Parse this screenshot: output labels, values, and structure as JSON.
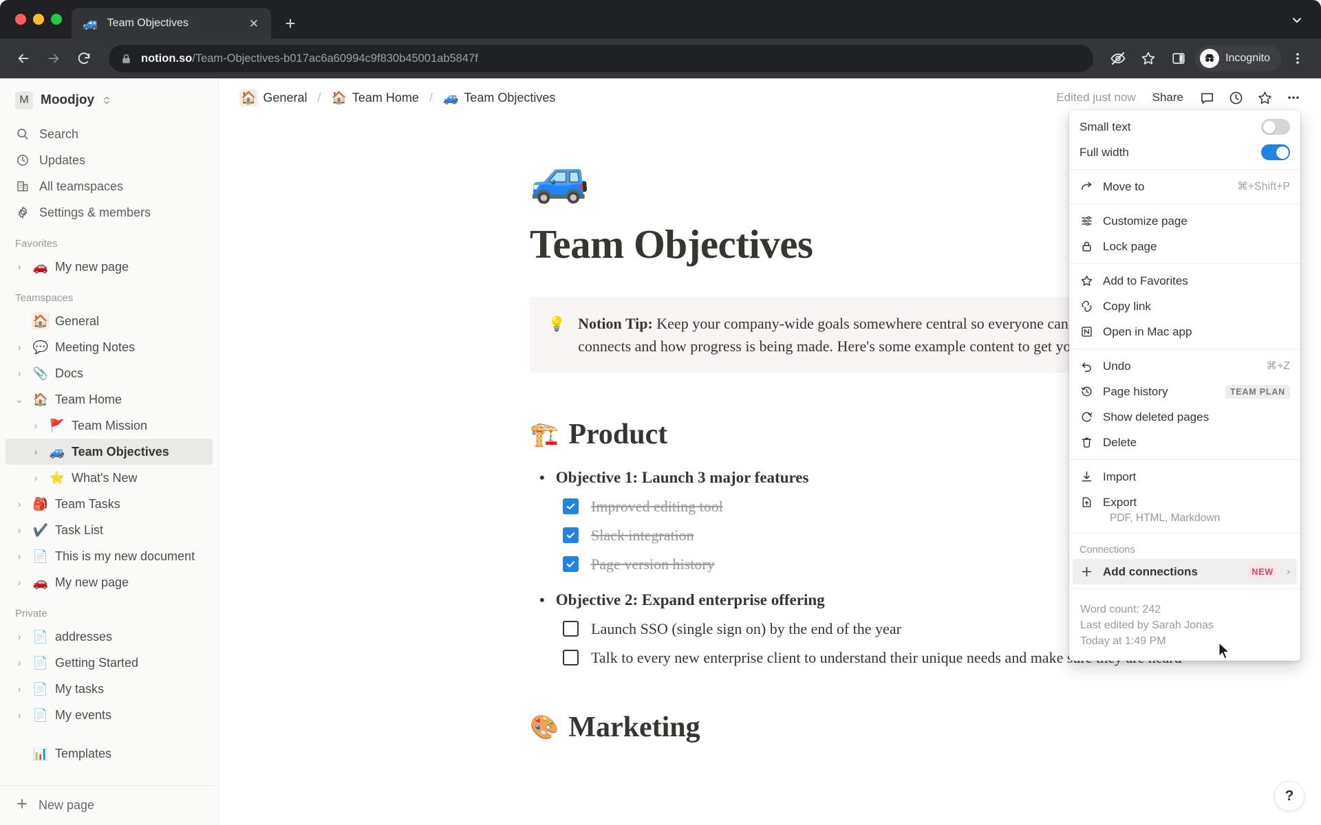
{
  "browser": {
    "tab": {
      "title": "Team Objectives",
      "favicon": "🚙",
      "close_label": "✕"
    },
    "new_tab_label": "+",
    "tab_list_label": "⌄",
    "url_host": "notion.so",
    "url_path": "/Team-Objectives-b017ac6a60994c9f830b45001ab5847f",
    "profile_label": "Incognito",
    "nav": {
      "back": "←",
      "forward": "→",
      "reload": "⟳"
    }
  },
  "sidebar": {
    "workspace": {
      "initial": "M",
      "name": "Moodjoy"
    },
    "nav": [
      {
        "label": "Search",
        "icon": "search-icon"
      },
      {
        "label": "Updates",
        "icon": "clock-icon"
      },
      {
        "label": "All teamspaces",
        "icon": "building-icon"
      },
      {
        "label": "Settings & members",
        "icon": "gear-icon"
      }
    ],
    "sections": [
      {
        "title": "Favorites",
        "items": [
          {
            "label": "My new page",
            "emoji": "🚗",
            "twisty": true,
            "indent": 0,
            "selected": false
          }
        ]
      },
      {
        "title": "Teamspaces",
        "items": [
          {
            "label": "General",
            "emoji": "🏠",
            "twisty": false,
            "indent": 0,
            "selected": false,
            "boxed": true
          },
          {
            "label": "Meeting Notes",
            "emoji": "💬",
            "twisty": true,
            "indent": 0,
            "selected": false
          },
          {
            "label": "Docs",
            "emoji": "📎",
            "twisty": true,
            "indent": 0,
            "selected": false
          },
          {
            "label": "Team Home",
            "emoji": "🏠",
            "twisty": true,
            "expanded": true,
            "indent": 0,
            "selected": false
          },
          {
            "label": "Team Mission",
            "emoji": "🚩",
            "twisty": true,
            "indent": 1,
            "selected": false
          },
          {
            "label": "Team Objectives",
            "emoji": "🚙",
            "twisty": true,
            "indent": 1,
            "selected": true
          },
          {
            "label": "What's New",
            "emoji": "⭐",
            "twisty": true,
            "indent": 1,
            "selected": false
          },
          {
            "label": "Team Tasks",
            "emoji": "🎒",
            "twisty": true,
            "indent": 0,
            "selected": false
          },
          {
            "label": "Task List",
            "emoji": "✔️",
            "twisty": true,
            "indent": 0,
            "selected": false
          },
          {
            "label": "This is my new document",
            "emoji": "📄",
            "twisty": true,
            "indent": 0,
            "selected": false
          },
          {
            "label": "My new page",
            "emoji": "🚗",
            "twisty": true,
            "indent": 0,
            "selected": false
          }
        ]
      },
      {
        "title": "Private",
        "items": [
          {
            "label": "addresses",
            "emoji": "📄",
            "twisty": true,
            "indent": 0,
            "selected": false
          },
          {
            "label": "Getting Started",
            "emoji": "📄",
            "twisty": true,
            "indent": 0,
            "selected": false
          },
          {
            "label": "My tasks",
            "emoji": "📄",
            "twisty": true,
            "indent": 0,
            "selected": false
          },
          {
            "label": "My events",
            "emoji": "📄",
            "twisty": true,
            "indent": 0,
            "selected": false
          },
          {
            "label": "Templates",
            "emoji": "📊",
            "twisty": false,
            "indent": 0,
            "selected": false
          }
        ]
      }
    ],
    "footer": {
      "label": "New page",
      "icon": "plus-icon"
    }
  },
  "topbar": {
    "breadcrumbs": [
      {
        "label": "General",
        "emoji": "🏠",
        "boxed": true
      },
      {
        "label": "Team Home",
        "emoji": "🏠",
        "boxed": false
      },
      {
        "label": "Team Objectives",
        "emoji": "🚙",
        "boxed": false
      }
    ],
    "separator": "/",
    "edited_status": "Edited just now",
    "share_label": "Share",
    "icons": [
      "comment-icon",
      "history-icon",
      "star-icon",
      "more-icon"
    ]
  },
  "page": {
    "emoji": "🚙",
    "title": "Team Objectives",
    "callout": {
      "emoji": "💡",
      "bold_prefix": "Notion Tip:",
      "text": " Keep your company-wide goals somewhere central so everyone can see how their work connects and how progress is being made. Here's some example content to get your started:"
    },
    "sections": [
      {
        "emoji": "🏗️",
        "heading": "Product",
        "objectives": [
          {
            "label": "Objective 1: Launch 3 major features",
            "todos": [
              {
                "text": "Improved editing tool",
                "checked": true
              },
              {
                "text": "Slack integration",
                "checked": true
              },
              {
                "text": "Page version history",
                "checked": true
              }
            ]
          },
          {
            "label": "Objective 2: Expand enterprise offering",
            "todos": [
              {
                "text": "Launch SSO (single sign on) by the end of the year",
                "checked": false
              },
              {
                "text": "Talk to every new enterprise client to understand their unique needs and make sure they are heard",
                "checked": false
              }
            ]
          }
        ]
      },
      {
        "emoji": "🎨",
        "heading": "Marketing",
        "objectives": []
      }
    ]
  },
  "menu": {
    "toggles": [
      {
        "label": "Small text",
        "on": false
      },
      {
        "label": "Full width",
        "on": true
      }
    ],
    "groups": [
      {
        "items": [
          {
            "label": "Move to",
            "icon": "arrow-move-icon",
            "shortcut": "⌘+Shift+P"
          }
        ]
      },
      {
        "items": [
          {
            "label": "Customize page",
            "icon": "sliders-icon"
          },
          {
            "label": "Lock page",
            "icon": "lock-icon"
          }
        ]
      },
      {
        "items": [
          {
            "label": "Add to Favorites",
            "icon": "star-icon"
          },
          {
            "label": "Copy link",
            "icon": "link-icon"
          },
          {
            "label": "Open in Mac app",
            "icon": "notion-app-icon"
          }
        ]
      },
      {
        "items": [
          {
            "label": "Undo",
            "icon": "undo-icon",
            "shortcut": "⌘+Z"
          },
          {
            "label": "Page history",
            "icon": "history-icon",
            "badge": "TEAM PLAN"
          },
          {
            "label": "Show deleted pages",
            "icon": "restore-icon"
          },
          {
            "label": "Delete",
            "icon": "trash-icon"
          }
        ]
      },
      {
        "items": [
          {
            "label": "Import",
            "icon": "import-icon"
          },
          {
            "label": "Export",
            "icon": "export-icon",
            "sub": "PDF, HTML, Markdown"
          }
        ]
      }
    ],
    "connections": {
      "heading": "Connections",
      "add_label": "Add connections",
      "badge": "NEW",
      "chevron": "›"
    },
    "meta": {
      "word_count": "Word count: 242",
      "last_edited": "Last edited by Sarah Jonas",
      "timestamp": "Today at 1:49 PM"
    }
  },
  "help": {
    "label": "?"
  }
}
